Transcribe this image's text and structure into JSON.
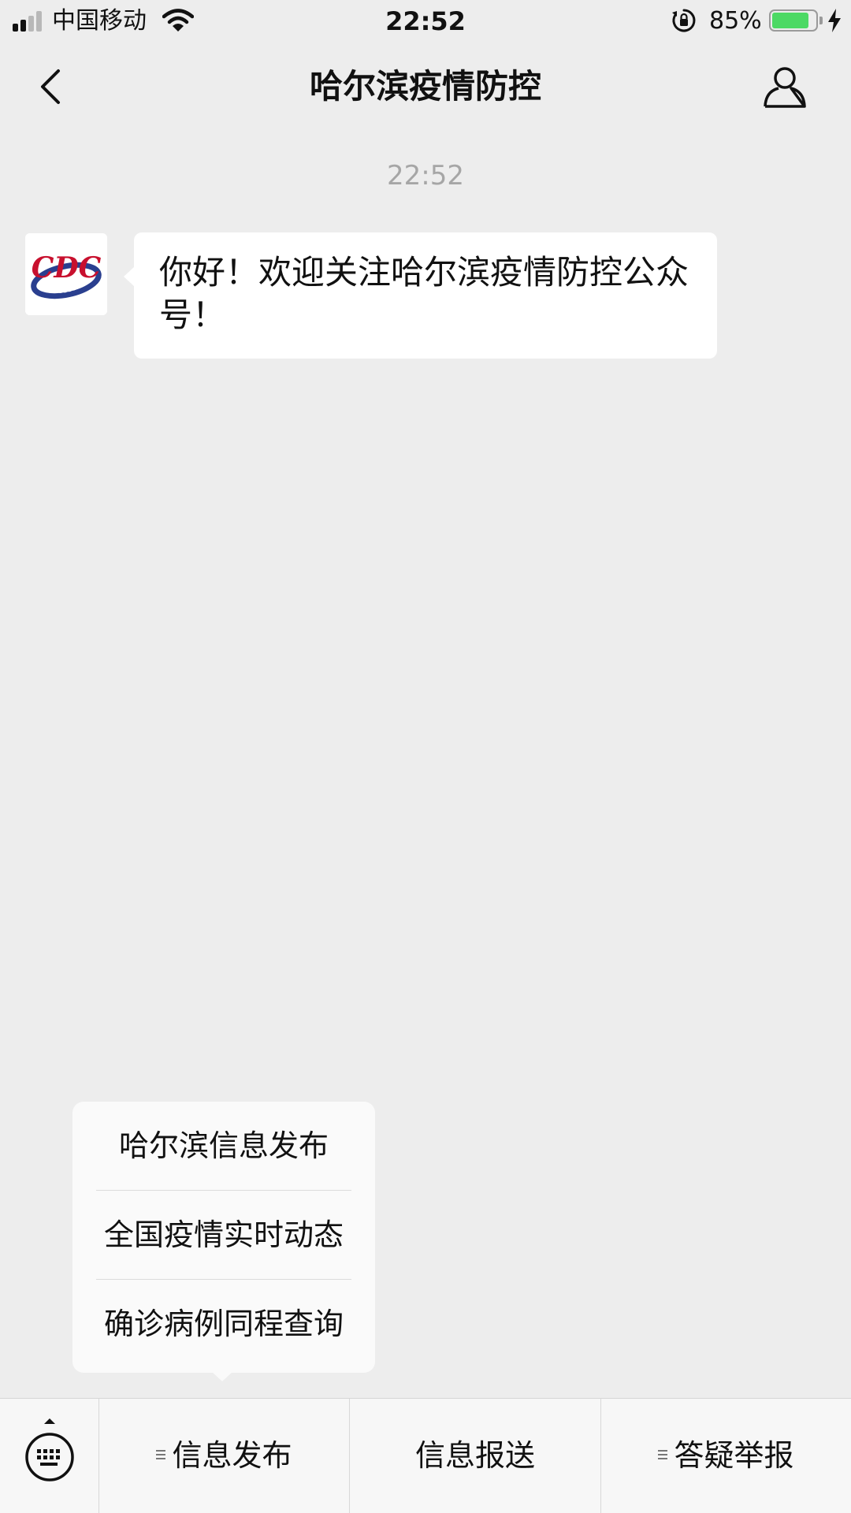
{
  "status_bar": {
    "carrier": "中国移动",
    "time": "22:52",
    "battery_percent": "85%",
    "battery_level": 0.85,
    "battery_color": "#4cd964",
    "icons": [
      "signal-icon",
      "wifi-icon",
      "orientation-lock-icon",
      "battery-icon",
      "charging-bolt-icon"
    ]
  },
  "nav": {
    "title": "哈尔滨疫情防控",
    "back_icon": "chevron-left-icon",
    "profile_icon": "person-icon"
  },
  "chat": {
    "timestamp": "22:52",
    "message": {
      "text": "你好！欢迎关注哈尔滨疫情防控公众号！",
      "avatar_logo_text": "CDC"
    }
  },
  "submenu": {
    "items": [
      {
        "label": "哈尔滨信息发布"
      },
      {
        "label": "全国疫情实时动态"
      },
      {
        "label": "确诊病例同程查询"
      }
    ]
  },
  "menu_bar": {
    "keyboard_icon": "keyboard-icon",
    "tabs": [
      {
        "label": "信息发布",
        "has_submenu": true
      },
      {
        "label": "信息报送",
        "has_submenu": false
      },
      {
        "label": "答疑举报",
        "has_submenu": true
      }
    ]
  }
}
